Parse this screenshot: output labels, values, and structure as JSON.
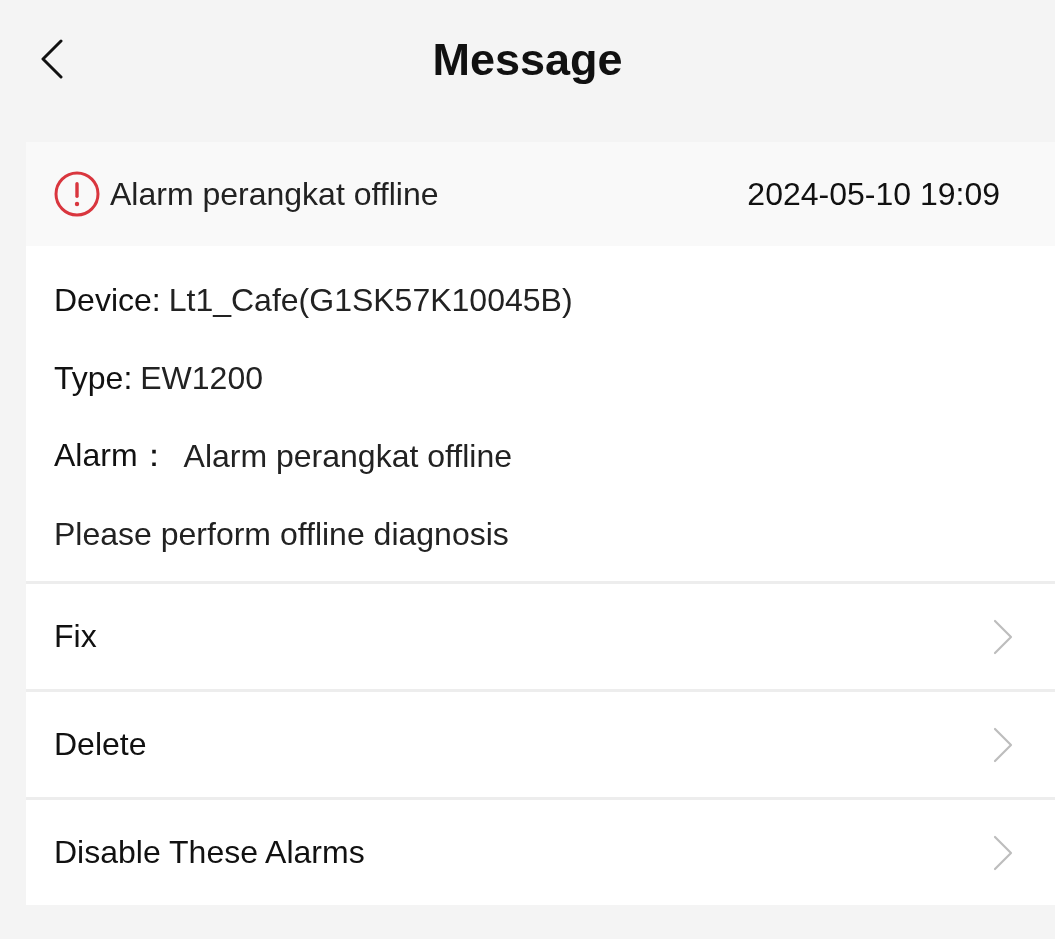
{
  "header": {
    "title": "Message"
  },
  "alarm": {
    "title": "Alarm perangkat offline",
    "time": "2024-05-10 19:09",
    "details": [
      {
        "label": "Device:",
        "value": "Lt1_Cafe(G1SK57K10045B)"
      },
      {
        "label": "Type:",
        "value": "EW1200"
      },
      {
        "label": "Alarm：",
        "value": "Alarm perangkat offline"
      }
    ],
    "hint": "Please perform offline diagnosis"
  },
  "actions": [
    {
      "label": "Fix"
    },
    {
      "label": "Delete"
    },
    {
      "label": "Disable These Alarms"
    }
  ]
}
